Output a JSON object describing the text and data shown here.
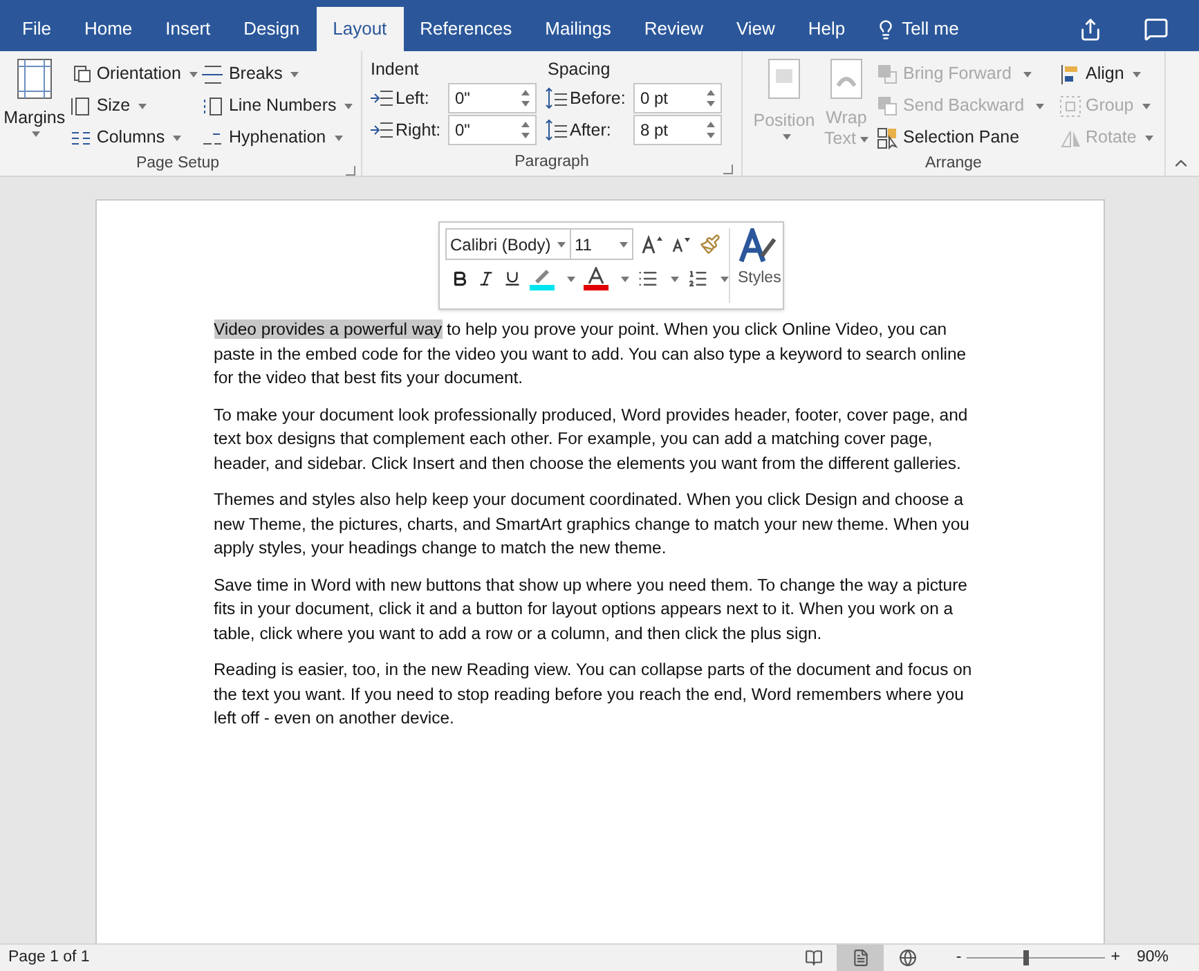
{
  "tabs": [
    {
      "label": "File",
      "selected": false
    },
    {
      "label": "Home",
      "selected": false
    },
    {
      "label": "Insert",
      "selected": false
    },
    {
      "label": "Design",
      "selected": false
    },
    {
      "label": "Layout",
      "selected": true
    },
    {
      "label": "References",
      "selected": false
    },
    {
      "label": "Mailings",
      "selected": false
    },
    {
      "label": "Review",
      "selected": false
    },
    {
      "label": "View",
      "selected": false
    },
    {
      "label": "Help",
      "selected": false
    }
  ],
  "tell_me": "Tell me",
  "page_setup": {
    "label": "Page Setup",
    "margins": "Margins",
    "columns": [
      [
        {
          "label": "Orientation",
          "kind": "orientation"
        },
        {
          "label": "Size",
          "kind": "size"
        },
        {
          "label": "Columns",
          "kind": "columns"
        }
      ],
      [
        {
          "label": "Breaks",
          "kind": "breaks"
        },
        {
          "label": "Line Numbers",
          "kind": "linenumbers"
        },
        {
          "label": "Hyphenation",
          "kind": "hyphenation"
        }
      ]
    ]
  },
  "paragraph": {
    "label": "Paragraph",
    "indent_label": "Indent",
    "spacing_label": "Spacing",
    "indent": [
      {
        "label": "Left:",
        "value": "0\""
      },
      {
        "label": "Right:",
        "value": "0\""
      }
    ],
    "spacing": [
      {
        "label": "Before:",
        "value": "0 pt"
      },
      {
        "label": "After:",
        "value": "8 pt"
      }
    ]
  },
  "arrange": {
    "label": "Arrange",
    "position": {
      "label": "Position",
      "disabled": true
    },
    "wrap": {
      "label": "Wrap",
      "label2": "Text",
      "disabled": true
    },
    "items": [
      {
        "label": "Bring Forward",
        "disabled": true,
        "kind": "bring"
      },
      {
        "label": "Send Backward",
        "disabled": true,
        "kind": "send"
      },
      {
        "label": "Selection Pane",
        "disabled": false,
        "kind": "pane"
      }
    ],
    "items2": [
      {
        "label": "Align",
        "disabled": false,
        "kind": "align"
      },
      {
        "label": "Group",
        "disabled": true,
        "kind": "group"
      },
      {
        "label": "Rotate",
        "disabled": true,
        "kind": "rotate"
      }
    ]
  },
  "mini_toolbar": {
    "font": "Calibri (Body)",
    "size": "11",
    "styles": "Styles"
  },
  "document": {
    "paragraphs": [
      {
        "selected_text": "Video provides a powerful way",
        "text": " to help you prove your point. When you click Online Video, you can paste in the embed code for the video you want to add. You can also type a keyword to search online for the video that best fits your document."
      },
      {
        "text": "To make your document look professionally produced, Word provides header, footer, cover page, and text box designs that complement each other. For example, you can add a matching cover page, header, and sidebar. Click Insert and then choose the elements you want from the different galleries."
      },
      {
        "text": "Themes and styles also help keep your document coordinated. When you click Design and choose a new Theme, the pictures, charts, and SmartArt graphics change to match your new theme. When you apply styles, your headings change to match the new theme."
      },
      {
        "text": "Save time in Word with new buttons that show up where you need them. To change the way a picture fits in your document, click it and a button for layout options appears next to it. When you work on a table, click where you want to add a row or a column, and then click the plus sign."
      },
      {
        "text": "Reading is easier, too, in the new Reading view. You can collapse parts of the document and focus on the text you want. If you need to stop reading before you reach the end, Word remembers where you left off - even on another device."
      }
    ]
  },
  "status_bar": {
    "page": "Page 1 of 1",
    "views": [
      {
        "kind": "read",
        "selected": false
      },
      {
        "kind": "print",
        "selected": true
      },
      {
        "kind": "web",
        "selected": false
      }
    ],
    "minus": "-",
    "plus": "+",
    "zoom": {
      "level": 0.42
    },
    "zoom_text": "90%"
  }
}
